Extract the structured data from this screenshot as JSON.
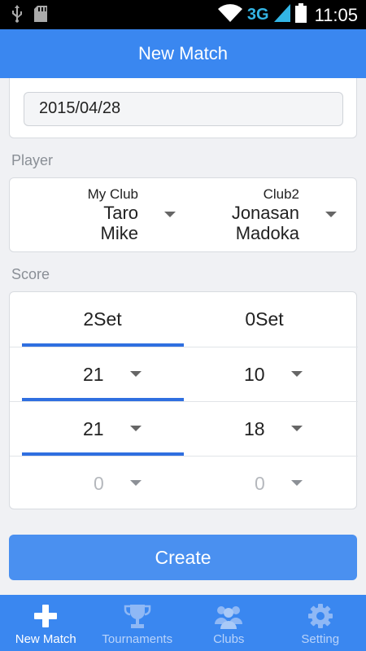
{
  "status_bar": {
    "network": "3G",
    "time": "11:05"
  },
  "header": {
    "title": "New Match"
  },
  "date": {
    "value": "2015/04/28"
  },
  "player": {
    "section_label": "Player",
    "left": {
      "club": "My Club",
      "players": [
        "Taro",
        "Mike"
      ]
    },
    "right": {
      "club": "Club2",
      "players": [
        "Jonasan",
        "Madoka"
      ]
    }
  },
  "score": {
    "section_label": "Score",
    "sets": {
      "left": "2Set",
      "right": "0Set"
    },
    "games": [
      {
        "left": "21",
        "right": "10",
        "left_active": true
      },
      {
        "left": "21",
        "right": "18",
        "left_active": true
      },
      {
        "left": "0",
        "right": "0",
        "left_active": false
      }
    ]
  },
  "create_button": {
    "label": "Create"
  },
  "bottom_nav": {
    "items": [
      {
        "label": "New Match",
        "icon": "plus-icon",
        "active": true
      },
      {
        "label": "Tournaments",
        "icon": "trophy-icon",
        "active": false
      },
      {
        "label": "Clubs",
        "icon": "people-icon",
        "active": false
      },
      {
        "label": "Setting",
        "icon": "gear-icon",
        "active": false
      }
    ]
  },
  "colors": {
    "primary": "#3a87f0",
    "button": "#4a90f0",
    "underline": "#2f6fe0",
    "background": "#f0f1f4"
  }
}
